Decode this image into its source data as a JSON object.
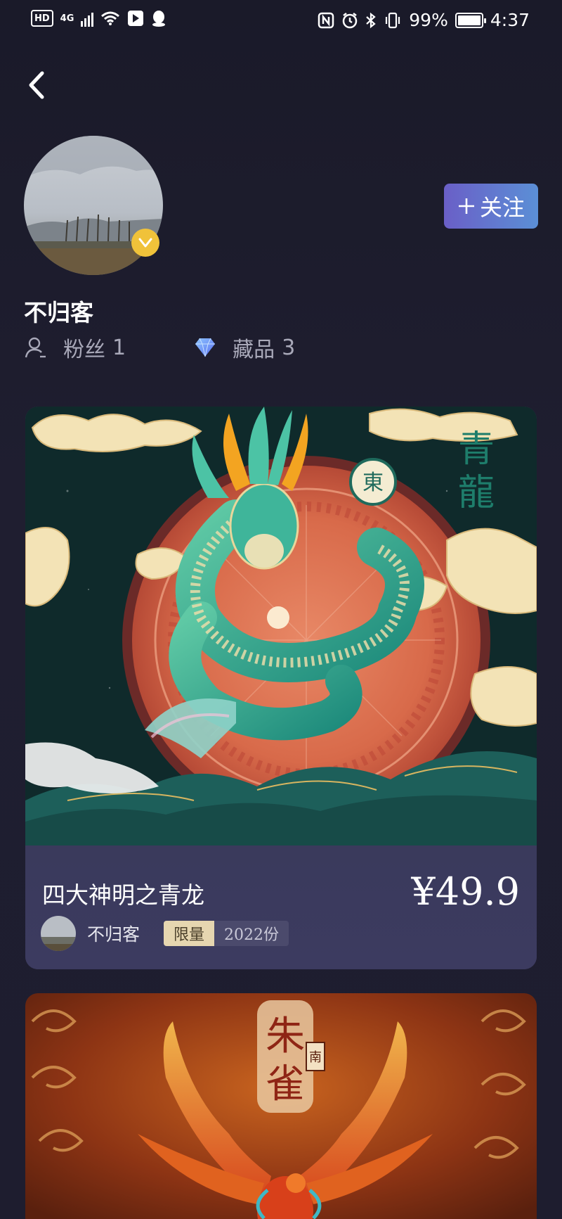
{
  "status_bar": {
    "network_chip": "HD",
    "network_type": "4G",
    "battery_percent": "99%",
    "time": "4:37"
  },
  "profile": {
    "username": "不归客",
    "follow_label": "关注",
    "follow_icon": "plus-icon",
    "fans_label": "粉丝",
    "fans_count": "1",
    "collections_label": "藏品",
    "collections_count": "3"
  },
  "nfts": [
    {
      "title": "四大神明之青龙",
      "price": "¥49.9",
      "creator": "不归客",
      "tag_label": "限量",
      "tag_value": "2022份",
      "art_text_1": "青",
      "art_text_2": "龍",
      "art_seal": "東"
    },
    {
      "art_text_1": "朱",
      "art_text_2": "雀",
      "art_seal": "南"
    }
  ],
  "colors": {
    "background": "#1d1c2c",
    "card_info": "#3b3a5e",
    "follow_gradient_start": "#6a5fc7",
    "follow_gradient_end": "#5b8fd6",
    "verified_badge": "#f0c23a",
    "tag_light": "#e6d6b0"
  }
}
